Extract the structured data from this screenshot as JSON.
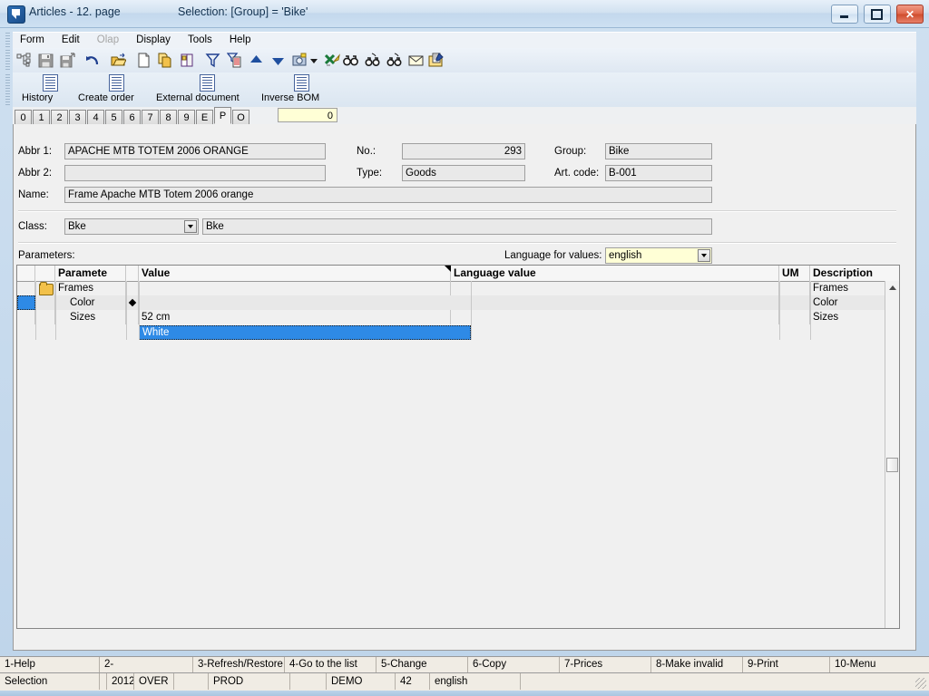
{
  "window": {
    "title": "Articles - 12. page",
    "selection": "Selection: [Group] = 'Bike'",
    "icon": "app-icon",
    "buttons": {
      "minimize": "minimize",
      "maximize": "maximize",
      "close": "close"
    }
  },
  "menubar": {
    "items": [
      {
        "label": "Form",
        "disabled": false
      },
      {
        "label": "Edit",
        "disabled": false
      },
      {
        "label": "Olap",
        "disabled": true
      },
      {
        "label": "Display",
        "disabled": false
      },
      {
        "label": "Tools",
        "disabled": false
      },
      {
        "label": "Help",
        "disabled": false
      }
    ]
  },
  "toolbar_primary": {
    "items": [
      {
        "name": "tree-structure-icon",
        "glyph": "tree"
      },
      {
        "name": "save-icon",
        "glyph": "save"
      },
      {
        "name": "save-as-icon",
        "glyph": "saveas"
      },
      {
        "name": "undo-icon",
        "glyph": "undo"
      },
      {
        "name": "open-folder-icon",
        "glyph": "open"
      },
      {
        "name": "new-document-icon",
        "glyph": "newdoc"
      },
      {
        "name": "copy-icon",
        "glyph": "copy"
      },
      {
        "name": "book-icon",
        "glyph": "book"
      },
      {
        "name": "filter-icon",
        "glyph": "filter"
      },
      {
        "name": "filter-list-icon",
        "glyph": "filterlist"
      },
      {
        "name": "move-up-icon",
        "glyph": "up"
      },
      {
        "name": "move-down-icon",
        "glyph": "down"
      },
      {
        "name": "camera-icon",
        "glyph": "camera"
      },
      {
        "name": "dropdown-arrow-icon",
        "glyph": "caret"
      },
      {
        "name": "export-icon",
        "glyph": "export"
      },
      {
        "name": "find-icon",
        "glyph": "binoculars"
      },
      {
        "name": "find-next-icon",
        "glyph": "binoculars2"
      },
      {
        "name": "find-prev-icon",
        "glyph": "binoculars3"
      },
      {
        "name": "mail-icon",
        "glyph": "mail"
      },
      {
        "name": "edit-document-icon",
        "glyph": "editdoc"
      }
    ]
  },
  "toolbar_secondary": {
    "buttons": [
      {
        "label": "History",
        "icon": "document-icon"
      },
      {
        "label": "Create order",
        "icon": "document-icon"
      },
      {
        "label": "External document",
        "icon": "document-icon"
      },
      {
        "label": "Inverse BOM",
        "icon": "document-icon"
      }
    ]
  },
  "tabs": {
    "items": [
      "0",
      "1",
      "2",
      "3",
      "4",
      "5",
      "6",
      "7",
      "8",
      "9",
      "E",
      "P",
      "O"
    ],
    "active": "P",
    "counter_value": "0"
  },
  "form": {
    "abbr1": {
      "label": "Abbr 1:",
      "value": "APACHE MTB TOTEM 2006 ORANGE"
    },
    "abbr2": {
      "label": "Abbr 2:",
      "value": ""
    },
    "name": {
      "label": "Name:",
      "value": "Frame Apache MTB Totem 2006 orange"
    },
    "no": {
      "label": "No.:",
      "value": "293"
    },
    "type": {
      "label": "Type:",
      "value": "Goods"
    },
    "group": {
      "label": "Group:",
      "value": "Bike"
    },
    "art_code": {
      "label": "Art. code:",
      "value": "B-001"
    },
    "class": {
      "label": "Class:",
      "value": "Bke",
      "description": "Bke"
    }
  },
  "parameters_section": {
    "title": "Parameters:",
    "language_label": "Language for values:",
    "language_value": "english"
  },
  "grid": {
    "columns": [
      {
        "key": "marker",
        "label": ""
      },
      {
        "key": "icon",
        "label": ""
      },
      {
        "key": "parameter",
        "label": "Paramete"
      },
      {
        "key": "flag",
        "label": ""
      },
      {
        "key": "value",
        "label": "Value"
      },
      {
        "key": "language_value",
        "label": "Language value"
      },
      {
        "key": "um",
        "label": "UM"
      },
      {
        "key": "description",
        "label": "Description"
      }
    ],
    "rows": [
      {
        "icon": "folder-icon",
        "parameter": "Frames",
        "flag": "",
        "value": "",
        "language_value": "",
        "um": "",
        "description": "Frames",
        "indent": false,
        "selected": false
      },
      {
        "icon": "",
        "parameter": "Color",
        "flag": "diamond-marker",
        "value": "White",
        "language_value": "",
        "um": "",
        "description": "Color",
        "indent": true,
        "selected": true
      },
      {
        "icon": "",
        "parameter": "Sizes",
        "flag": "",
        "value": "52 cm",
        "language_value": "",
        "um": "",
        "description": "Sizes",
        "indent": true,
        "selected": false
      }
    ],
    "scrollbar": {
      "up_arrow": "scroll-up-icon",
      "thumb": "scroll-thumb"
    }
  },
  "function_keys": [
    "1-Help",
    "2-",
    "3-Refresh/Restore",
    "4-Go to the list",
    "5-Change",
    "6-Copy",
    "7-Prices",
    "8-Make invalid",
    "9-Print",
    "10-Menu"
  ],
  "status_bar": [
    "Selection",
    "",
    "2012",
    "OVER",
    "",
    "PROD",
    "",
    "DEMO",
    "42",
    "english",
    ""
  ],
  "colors": {
    "selection_blue": "#2e8ae6",
    "title_bar": "#cfe0f0",
    "panel": "#f0f0f0",
    "field": "#e9e9e9",
    "yellow_field": "#ffffd6",
    "status": "#f0ece4"
  }
}
